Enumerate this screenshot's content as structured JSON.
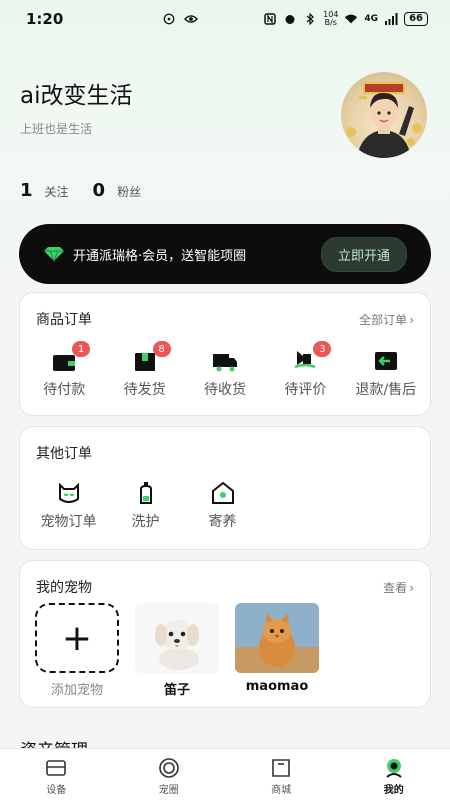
{
  "status_bar": {
    "time": "1:20",
    "net_speed_value": "104",
    "net_speed_unit": "B/s",
    "network": "4G",
    "battery": "66"
  },
  "profile": {
    "username": "ai改变生活",
    "signature": "上班也是生活",
    "stats": [
      {
        "count": "1",
        "label": "关注"
      },
      {
        "count": "0",
        "label": "粉丝"
      }
    ]
  },
  "vip": {
    "text": "开通派瑞格·会员，送智能项圈",
    "button": "立即开通",
    "accent": "#3dd06a"
  },
  "product_orders": {
    "title": "商品订单",
    "more": "全部订单",
    "items": [
      {
        "label": "待付款",
        "badge": "1",
        "icon": "wallet-icon"
      },
      {
        "label": "待发货",
        "badge": "8",
        "icon": "package-icon"
      },
      {
        "label": "待收货",
        "badge": "",
        "icon": "truck-icon"
      },
      {
        "label": "待评价",
        "badge": "3",
        "icon": "review-icon"
      },
      {
        "label": "退款/售后",
        "badge": "",
        "icon": "refund-icon"
      }
    ]
  },
  "other_orders": {
    "title": "其他订单",
    "items": [
      {
        "label": "宠物订单",
        "icon": "cat-icon"
      },
      {
        "label": "洗护",
        "icon": "bottle-icon"
      },
      {
        "label": "寄养",
        "icon": "house-icon"
      }
    ]
  },
  "my_pets": {
    "title": "我的宠物",
    "more": "查看",
    "add_label": "添加宠物",
    "pets": [
      {
        "name": "笛子"
      },
      {
        "name": "maomao"
      }
    ]
  },
  "assets": {
    "title": "资产管理"
  },
  "tabbar": {
    "tabs": [
      {
        "label": "设备",
        "icon": "device-icon"
      },
      {
        "label": "宠圈",
        "icon": "circle-icon"
      },
      {
        "label": "商城",
        "icon": "shop-icon"
      },
      {
        "label": "我的",
        "icon": "profile-icon",
        "active": true
      }
    ]
  }
}
